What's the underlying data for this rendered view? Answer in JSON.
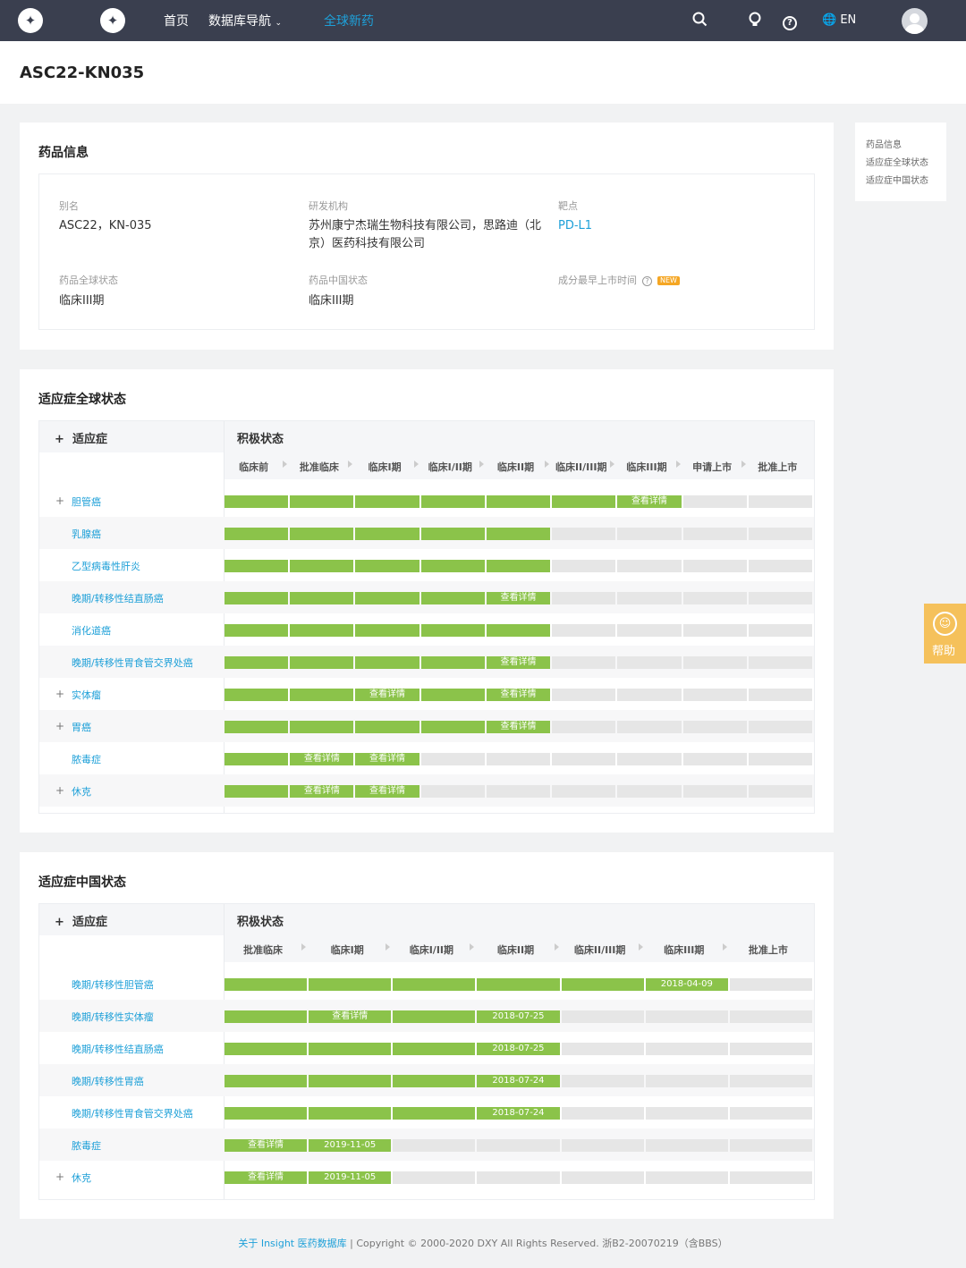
{
  "nav": {
    "home": "首页",
    "database_nav": "数据库导航",
    "global_new_drugs": "全球新药",
    "lang": "EN"
  },
  "page": {
    "title": "ASC22-KN035"
  },
  "drug_info": {
    "section_title": "药品信息",
    "alias_label": "别名",
    "alias_value": "ASC22，KN-035",
    "developer_label": "研发机构",
    "developer_value_line1": "苏州康宁杰瑞生物科技有限公司，思路迪（北",
    "developer_value_line2": "京）医药科技有限公司",
    "target_label": "靶点",
    "target_value": "PD-L1",
    "global_status_label": "药品全球状态",
    "global_status_value": "临床III期",
    "china_status_label": "药品中国状态",
    "china_status_value": "临床III期",
    "earliest_launch_label": "成分最早上市时间",
    "new_badge": "NEW"
  },
  "global_status": {
    "section_title": "适应症全球状态",
    "col_indication": "适应症",
    "col_status": "积极状态",
    "phases": [
      "临床前",
      "批准临床",
      "临床I期",
      "临床I/II期",
      "临床II期",
      "临床II/III期",
      "临床III期",
      "申请上市",
      "批准上市"
    ],
    "rows": [
      {
        "name": "胆管癌",
        "expand": "+",
        "cells": [
          1,
          1,
          1,
          1,
          1,
          1,
          "查看详情",
          0,
          0
        ]
      },
      {
        "name": "乳腺癌",
        "expand": "",
        "cells": [
          1,
          1,
          1,
          1,
          1,
          0,
          0,
          0,
          0
        ]
      },
      {
        "name": "乙型病毒性肝炎",
        "expand": "",
        "cells": [
          1,
          1,
          1,
          1,
          1,
          0,
          0,
          0,
          0
        ]
      },
      {
        "name": "晚期/转移性结直肠癌",
        "expand": "",
        "cells": [
          1,
          1,
          1,
          1,
          "查看详情",
          0,
          0,
          0,
          0
        ]
      },
      {
        "name": "消化道癌",
        "expand": "",
        "cells": [
          1,
          1,
          1,
          1,
          1,
          0,
          0,
          0,
          0
        ]
      },
      {
        "name": "晚期/转移性胃食管交界处癌",
        "expand": "",
        "cells": [
          1,
          1,
          1,
          1,
          "查看详情",
          0,
          0,
          0,
          0
        ]
      },
      {
        "name": "实体瘤",
        "expand": "+",
        "cells": [
          1,
          1,
          "查看详情",
          1,
          "查看详情",
          0,
          0,
          0,
          0
        ]
      },
      {
        "name": "胃癌",
        "expand": "+",
        "cells": [
          1,
          1,
          1,
          1,
          "查看详情",
          0,
          0,
          0,
          0
        ]
      },
      {
        "name": "脓毒症",
        "expand": "",
        "cells": [
          1,
          "查看详情",
          "查看详情",
          0,
          0,
          0,
          0,
          0,
          0
        ]
      },
      {
        "name": "休克",
        "expand": "+",
        "cells": [
          1,
          "查看详情",
          "查看详情",
          0,
          0,
          0,
          0,
          0,
          0
        ]
      }
    ]
  },
  "china_status": {
    "section_title": "适应症中国状态",
    "col_indication": "适应症",
    "col_status": "积极状态",
    "phases": [
      "批准临床",
      "临床I期",
      "临床I/II期",
      "临床II期",
      "临床II/III期",
      "临床III期",
      "批准上市"
    ],
    "rows": [
      {
        "name": "晚期/转移性胆管癌",
        "expand": "",
        "cells": [
          1,
          1,
          1,
          1,
          1,
          "2018-04-09",
          0
        ]
      },
      {
        "name": "晚期/转移性实体瘤",
        "expand": "",
        "cells": [
          1,
          "查看详情",
          1,
          "2018-07-25",
          0,
          0,
          0
        ]
      },
      {
        "name": "晚期/转移性结直肠癌",
        "expand": "",
        "cells": [
          1,
          1,
          1,
          "2018-07-25",
          0,
          0,
          0
        ]
      },
      {
        "name": "晚期/转移性胃癌",
        "expand": "",
        "cells": [
          1,
          1,
          1,
          "2018-07-24",
          0,
          0,
          0
        ]
      },
      {
        "name": "晚期/转移性胃食管交界处癌",
        "expand": "",
        "cells": [
          1,
          1,
          1,
          "2018-07-24",
          0,
          0,
          0
        ]
      },
      {
        "name": "脓毒症",
        "expand": "",
        "cells": [
          "查看详情",
          "2019-11-05",
          0,
          0,
          0,
          0,
          0
        ]
      },
      {
        "name": "休克",
        "expand": "+",
        "cells": [
          "查看详情",
          "2019-11-05",
          0,
          0,
          0,
          0,
          0
        ]
      }
    ]
  },
  "right_nav": {
    "items": [
      "药品信息",
      "适应症全球状态",
      "适应症中国状态"
    ]
  },
  "help": {
    "label": "帮助"
  },
  "footer": {
    "about_link": "关于 Insight 医药数据库",
    "separator": "|",
    "copyright": "Copyright © 2000-2020 DXY All Rights Reserved. 浙B2-20070219（含BBS）"
  },
  "colors": {
    "nav_bg": "#3a3f4f",
    "accent": "#1ea0d8",
    "bar_on": "#8bc34a",
    "bar_off": "#e6e6e6",
    "help": "#f5c15b",
    "new_badge": "#f5a623"
  }
}
